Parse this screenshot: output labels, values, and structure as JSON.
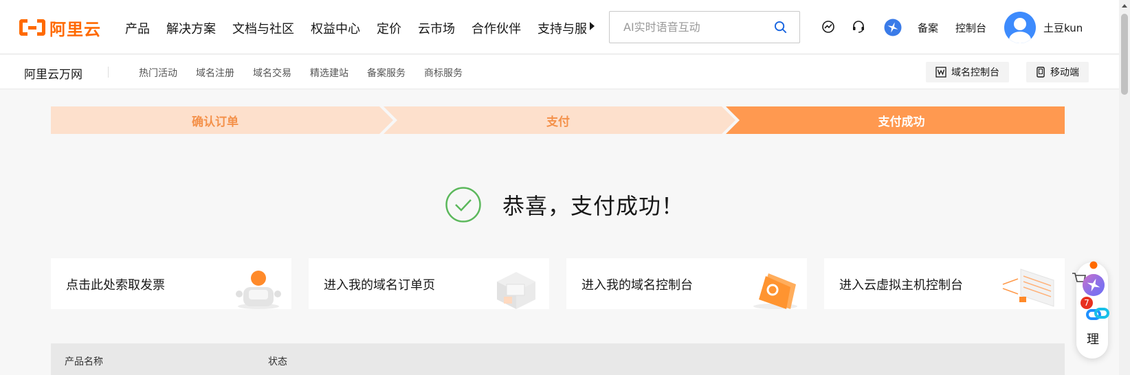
{
  "header": {
    "logo_text": "阿里云",
    "nav": [
      "产品",
      "解决方案",
      "文档与社区",
      "权益中心",
      "定价",
      "云市场",
      "合作伙伴",
      "支持与服务"
    ],
    "search_placeholder": "AI实时语音互动",
    "links": {
      "beian": "备案",
      "console": "控制台"
    },
    "username": "土豆kun",
    "icons": [
      "dashboard-icon",
      "headset-icon",
      "starburst-icon",
      "search-icon",
      "avatar-icon"
    ]
  },
  "subheader": {
    "title": "阿里云万网",
    "nav": [
      "热门活动",
      "域名注册",
      "域名交易",
      "精选建站",
      "备案服务",
      "商标服务"
    ],
    "domain_console": "域名控制台",
    "mobile": "移动端"
  },
  "steps": [
    {
      "label": "确认订单",
      "state": "done"
    },
    {
      "label": "支付",
      "state": "done"
    },
    {
      "label": "支付成功",
      "state": "active"
    }
  ],
  "colors": {
    "accent": "#ff6a00",
    "step_done_bg": "#fde0cc",
    "step_done_text": "#f4914a",
    "step_active_bg": "#ff9950",
    "success_green": "#5cb85c"
  },
  "success": {
    "message": "恭喜，支付成功！"
  },
  "cards": [
    {
      "label": "点击此处索取发票"
    },
    {
      "label": "进入我的域名订单页"
    },
    {
      "label": "进入我的域名控制台"
    },
    {
      "label": "进入云虚拟主机控制台"
    }
  ],
  "table": {
    "columns": [
      "产品名称",
      "状态"
    ]
  },
  "float": {
    "badge": "7",
    "label": "理"
  }
}
